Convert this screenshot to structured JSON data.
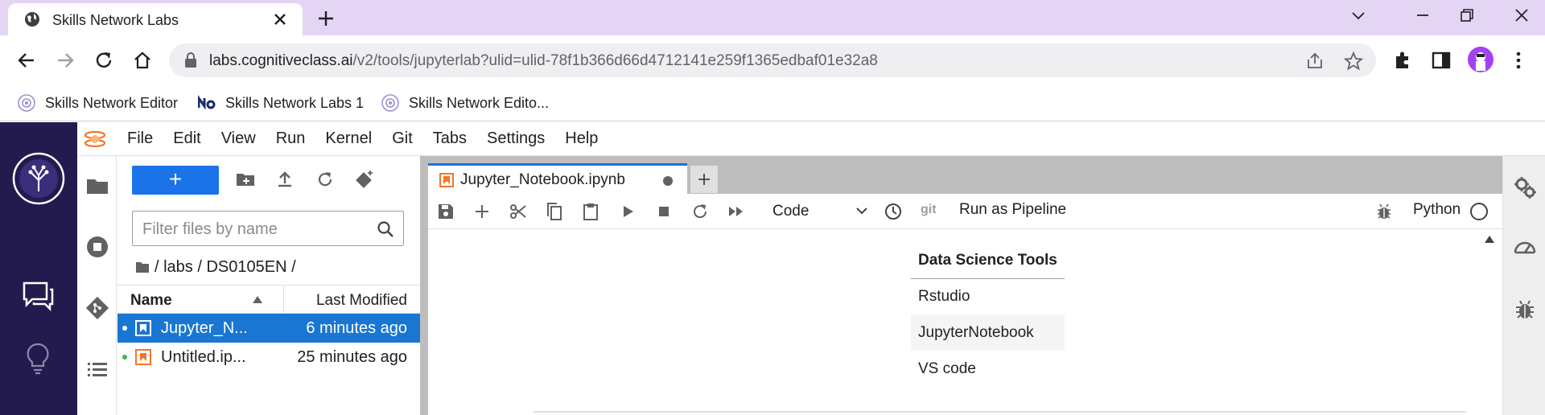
{
  "browser": {
    "tab_title": "Skills Network Labs",
    "url_host": "labs.cognitiveclass.ai",
    "url_path": "/v2/tools/jupyterlab?ulid=ulid-78f1b366d66d4712141e259f1365edbaf01e32a8",
    "bookmarks": [
      {
        "label": "Skills Network Editor",
        "icon": "skills-network-icon"
      },
      {
        "label": "Skills Network Labs 1",
        "icon": "sn-logo-icon"
      },
      {
        "label": "Skills Network Edito...",
        "icon": "skills-network-icon"
      }
    ]
  },
  "jupyter": {
    "menu": [
      "File",
      "Edit",
      "View",
      "Run",
      "Kernel",
      "Git",
      "Tabs",
      "Settings",
      "Help"
    ],
    "filebrowser": {
      "new_label": "+",
      "filter_placeholder": "Filter files by name",
      "breadcrumb": "/ labs / DS0105EN /",
      "col_name": "Name",
      "col_modified": "Last Modified",
      "files": [
        {
          "name": "Jupyter_N...",
          "modified": "6 minutes ago",
          "selected": true
        },
        {
          "name": "Untitled.ip...",
          "modified": "25 minutes ago",
          "selected": false
        }
      ]
    },
    "notebook": {
      "tab_title": "Jupyter_Notebook.ipynb",
      "cell_type": "Code",
      "git_label": "git",
      "pipeline_label": "Run as Pipeline",
      "kernel": "Python",
      "table": {
        "header": "Data Science Tools",
        "rows": [
          "Rstudio",
          "JupyterNotebook",
          "VS code"
        ]
      }
    }
  },
  "colors": {
    "tabstrip": "#e5d5f5",
    "sn_rail": "#231a4e",
    "accent_blue": "#1976d2",
    "notebook_orange": "#f37726"
  }
}
